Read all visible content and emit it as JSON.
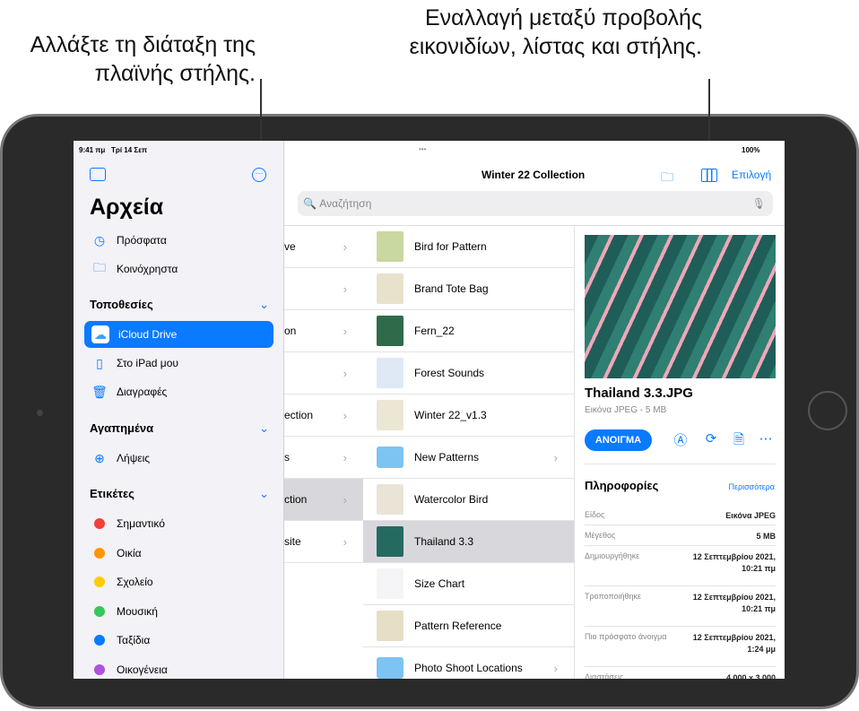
{
  "callouts": {
    "left": "Αλλάξτε τη διάταξη της πλαϊνής στήλης.",
    "right": "Εναλλαγή μεταξύ προβολής εικονιδίων, λίστας και στήλης."
  },
  "status": {
    "time": "9:41 πμ",
    "date": "Τρί 14 Σεπ",
    "battery": "100%"
  },
  "sidebar": {
    "title": "Αρχεία",
    "top_items": [
      {
        "label": "Πρόσφατα",
        "icon": "clock-icon"
      },
      {
        "label": "Κοινόχρηστα",
        "icon": "shared-folder-icon"
      }
    ],
    "locations_header": "Τοποθεσίες",
    "locations": [
      {
        "label": "iCloud Drive",
        "icon": "icloud-icon",
        "selected": true
      },
      {
        "label": "Στο iPad μου",
        "icon": "ipad-icon"
      },
      {
        "label": "Διαγραφές",
        "icon": "trash-icon"
      }
    ],
    "favorites_header": "Αγαπημένα",
    "favorites": [
      {
        "label": "Λήψεις",
        "icon": "download-icon"
      }
    ],
    "tags_header": "Ετικέτες",
    "tags": [
      {
        "label": "Σημαντικό",
        "color": "#f2403a"
      },
      {
        "label": "Οικία",
        "color": "#ff9500"
      },
      {
        "label": "Σχολείο",
        "color": "#ffcc00"
      },
      {
        "label": "Μουσική",
        "color": "#34c759"
      },
      {
        "label": "Ταξίδια",
        "color": "#0a7aff"
      },
      {
        "label": "Οικογένεια",
        "color": "#af52de"
      }
    ]
  },
  "toolbar": {
    "title": "Winter 22 Collection",
    "select": "Επιλογή",
    "search_placeholder": "Αναζήτηση"
  },
  "column1": [
    "ve",
    "",
    "on",
    "",
    "ection",
    "s",
    "ction",
    "site"
  ],
  "column2": [
    {
      "name": "Bird for Pattern",
      "color": "#c8d8a0"
    },
    {
      "name": "Brand Tote Bag",
      "color": "#e8e2cc"
    },
    {
      "name": "Fern_22",
      "color": "#2f6b4a"
    },
    {
      "name": "Forest Sounds",
      "color": "#dfe8f5"
    },
    {
      "name": "Winter 22_v1.3",
      "color": "#ece6d4"
    },
    {
      "name": "New Patterns",
      "color": "#7cc4f2",
      "folder": true
    },
    {
      "name": "Watercolor Bird",
      "color": "#e9e4d6"
    },
    {
      "name": "Thailand 3.3",
      "color": "#256a60",
      "selected": true
    },
    {
      "name": "Size Chart",
      "color": "#f5f5f7"
    },
    {
      "name": "Pattern Reference",
      "color": "#e6dfc6"
    },
    {
      "name": "Photo Shoot Locations",
      "color": "#7cc4f2",
      "folder": true
    }
  ],
  "preview": {
    "name": "Thailand 3.3.JPG",
    "subtitle": "Εικόνα JPEG - 5 MB",
    "open": "ΑΝΟΙΓΜΑ",
    "info_title": "Πληροφορίες",
    "more": "Περισσότερα",
    "info": [
      {
        "k": "Είδος",
        "v": "Εικόνα JPEG"
      },
      {
        "k": "Μέγεθος",
        "v": "5 MB"
      },
      {
        "k": "Δημιουργήθηκε",
        "v": "12 Σεπτεμβρίου 2021, 10:21 πμ"
      },
      {
        "k": "Τροποποιήθηκε",
        "v": "12 Σεπτεμβρίου 2021, 10:21 πμ"
      },
      {
        "k": "Πιο πρόσφατο άνοιγμα",
        "v": "12 Σεπτεμβρίου 2021, 1:24 μμ"
      },
      {
        "k": "Διαστάσεις",
        "v": "4.000 x 3.000"
      }
    ]
  }
}
